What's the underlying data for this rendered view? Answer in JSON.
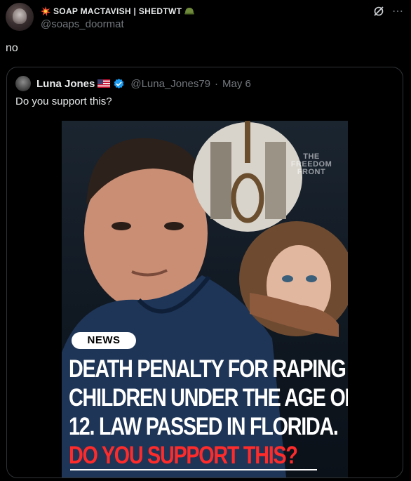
{
  "post": {
    "author_name": "SOAP MACTAVISH | SHEDTWT",
    "author_handle": "@soaps_doormat",
    "text": "no"
  },
  "quoted_post": {
    "author_name": "Luna Jones",
    "author_handle": "@Luna_Jones79",
    "separator": "·",
    "date": "May 6",
    "text": "Do you support this?",
    "media": {
      "tag": "NEWS",
      "headline_line1": "DEATH PENALTY FOR RAPING",
      "headline_line2": "CHILDREN UNDER THE AGE OF",
      "headline_line3": "12. LAW PASSED IN FLORIDA.",
      "cta": "DO YOU SUPPORT THIS?",
      "watermark_line1": "THE",
      "watermark_line2": "FREEDOM",
      "watermark_line3": "FRONT"
    }
  },
  "icons": {
    "more": "⋯"
  },
  "colors": {
    "background": "#000000",
    "text": "#e7e9ea",
    "muted": "#71767b",
    "verified": "#1d9bf0",
    "cta_red": "#ff2b2b"
  }
}
